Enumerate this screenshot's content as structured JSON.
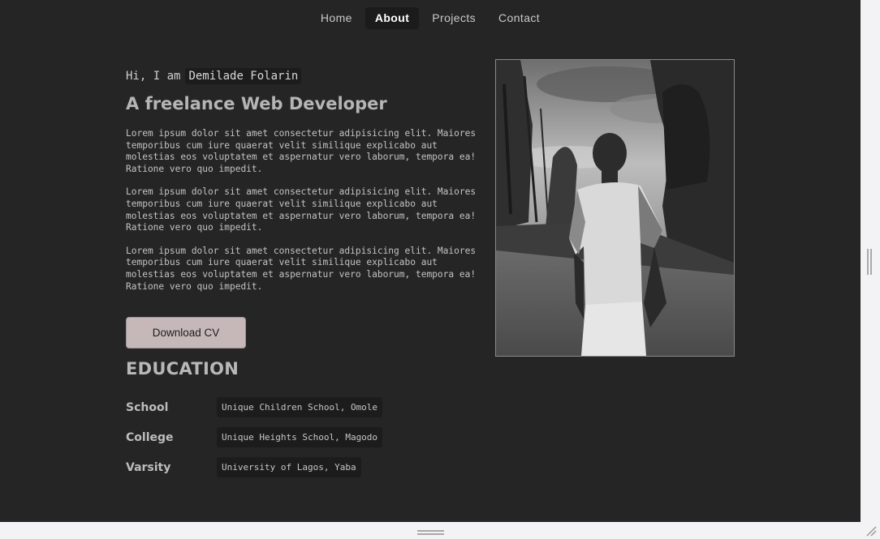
{
  "nav": {
    "items": [
      {
        "label": "Home"
      },
      {
        "label": "About"
      },
      {
        "label": "Projects"
      },
      {
        "label": "Contact"
      }
    ],
    "active": "About"
  },
  "hero": {
    "greeting_prefix": "Hi, I am",
    "name": "Demilade Folarin",
    "role": "A freelance Web Developer",
    "paragraphs": [
      "Lorem ipsum dolor sit amet consectetur adipisicing elit. Maiores temporibus cum iure quaerat velit similique explicabo aut molestias eos voluptatem et aspernatur vero laborum, tempora ea! Ratione vero quo impedit.",
      "Lorem ipsum dolor sit amet consectetur adipisicing elit. Maiores temporibus cum iure quaerat velit similique explicabo aut molestias eos voluptatem et aspernatur vero laborum, tempora ea! Ratione vero quo impedit.",
      "Lorem ipsum dolor sit amet consectetur adipisicing elit. Maiores temporibus cum iure quaerat velit similique explicabo aut molestias eos voluptatem et aspernatur vero laborum, tempora ea! Ratione vero quo impedit."
    ],
    "download_label": "Download CV"
  },
  "education": {
    "title": "EDUCATION",
    "rows": [
      {
        "label": "School",
        "value": "Unique Children School, Omole"
      },
      {
        "label": "College",
        "value": "Unique Heights School, Magodo"
      },
      {
        "label": "Varsity",
        "value": "University of Lagos, Yaba"
      }
    ]
  },
  "colors": {
    "background": "#252525",
    "chip": "#1c1c1c",
    "button": "#c6b8b9",
    "text": "#c3c3c3"
  }
}
